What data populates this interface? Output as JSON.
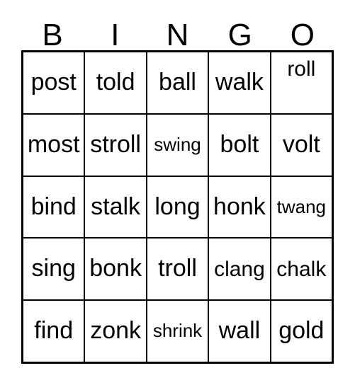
{
  "card": {
    "title": "BINGO",
    "headers": [
      "B",
      "I",
      "N",
      "G",
      "O"
    ],
    "rows": [
      [
        {
          "word": "post",
          "size": "md",
          "align": "center"
        },
        {
          "word": "told",
          "size": "md",
          "align": "center"
        },
        {
          "word": "ball",
          "size": "md",
          "align": "center"
        },
        {
          "word": "walk",
          "size": "md",
          "align": "center"
        },
        {
          "word": "roll",
          "size": "sm",
          "align": "top"
        }
      ],
      [
        {
          "word": "most",
          "size": "md",
          "align": "center"
        },
        {
          "word": "stroll",
          "size": "md",
          "align": "center"
        },
        {
          "word": "swing",
          "size": "xs",
          "align": "center"
        },
        {
          "word": "bolt",
          "size": "md",
          "align": "center"
        },
        {
          "word": "volt",
          "size": "md",
          "align": "center"
        }
      ],
      [
        {
          "word": "bind",
          "size": "md",
          "align": "center"
        },
        {
          "word": "stalk",
          "size": "md",
          "align": "center"
        },
        {
          "word": "long",
          "size": "md",
          "align": "center"
        },
        {
          "word": "honk",
          "size": "md",
          "align": "center"
        },
        {
          "word": "twang",
          "size": "xs",
          "align": "center"
        }
      ],
      [
        {
          "word": "sing",
          "size": "md",
          "align": "center"
        },
        {
          "word": "bonk",
          "size": "md",
          "align": "center"
        },
        {
          "word": "troll",
          "size": "md",
          "align": "center"
        },
        {
          "word": "clang",
          "size": "sm",
          "align": "center"
        },
        {
          "word": "chalk",
          "size": "sm",
          "align": "center"
        }
      ],
      [
        {
          "word": "find",
          "size": "md",
          "align": "center"
        },
        {
          "word": "zonk",
          "size": "md",
          "align": "center"
        },
        {
          "word": "shrink",
          "size": "xs",
          "align": "center"
        },
        {
          "word": "wall",
          "size": "md",
          "align": "center"
        },
        {
          "word": "gold",
          "size": "md",
          "align": "center"
        }
      ]
    ],
    "colors": {
      "background": "#ffffff",
      "ink": "#000000",
      "grid_line": "#000000"
    }
  }
}
